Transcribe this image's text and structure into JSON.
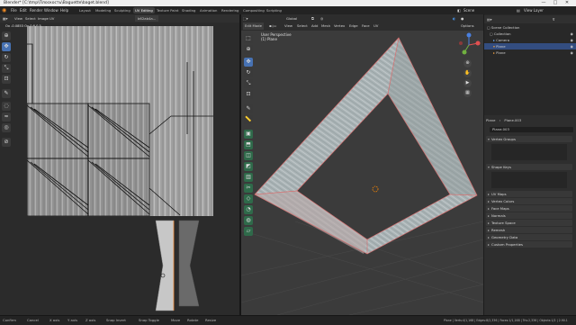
{
  "titlebar": {
    "title": "Blender* [C:\\tmp\\Плоскость\\Baguette\\baget.blend]",
    "controls": [
      "—",
      "□",
      "✕"
    ]
  },
  "menus": [
    "File",
    "Edit",
    "Render",
    "Window",
    "Help"
  ],
  "workspaces": [
    "Layout",
    "Modeling",
    "Sculpting",
    "UV Editing",
    "Texture Paint",
    "Shading",
    "Animation",
    "Rendering",
    "Compositing",
    "Scripting"
  ],
  "active_workspace": "UV Editing",
  "scene": {
    "label": "Scene",
    "view_layer": "View Layer"
  },
  "uv_editor": {
    "header": [
      "View",
      "Select",
      "Image",
      "UV"
    ],
    "image_name": "b62ab4a...",
    "coords": "Ox -0.0853  Oy 0.6 0.5 ...",
    "tools": [
      "cursor-icon",
      "move-icon",
      "rotate-icon",
      "scale-icon",
      "transform-icon",
      "annotate-icon",
      "grab-icon",
      "relax-icon",
      "pinch-icon",
      "sample-icon"
    ]
  },
  "viewport": {
    "mode": "Edit Mode",
    "orientation": "Global",
    "menu": [
      "View",
      "Select",
      "Add",
      "Mesh",
      "Vertex",
      "Edge",
      "Face",
      "UV"
    ],
    "info_line1": "User Perspective",
    "info_line2": "(1) Plane",
    "options": "Options"
  },
  "outliner": {
    "rows": [
      {
        "label": "Scene Collection",
        "selected": false
      },
      {
        "label": "Collection",
        "selected": false
      },
      {
        "label": "Camera",
        "selected": false
      },
      {
        "label": "Plane",
        "selected": true
      },
      {
        "label": "Plane",
        "selected": false
      }
    ]
  },
  "properties": {
    "object": "Plane",
    "data": "Plane.003",
    "mesh_name": "Plane.003",
    "panels": [
      "Vertex Groups",
      "Shape Keys",
      "UV Maps",
      "Vertex Colors",
      "Face Maps",
      "Normals",
      "Texture Space",
      "Remesh",
      "Geometry Data",
      "Custom Properties"
    ]
  },
  "statusbar": {
    "left": [
      "Confirm",
      "Cancel",
      "X axis",
      "Y axis",
      "Z axis",
      "Snap Invert",
      "Snap Toggle",
      "Move",
      "Rotate",
      "Resize"
    ],
    "right": "Plane | Verts:4/1,168 | Edges:8/2,336 | Faces:1/1,168 | Tris:2,336 | Objects:1/2 | 2.90.1"
  }
}
